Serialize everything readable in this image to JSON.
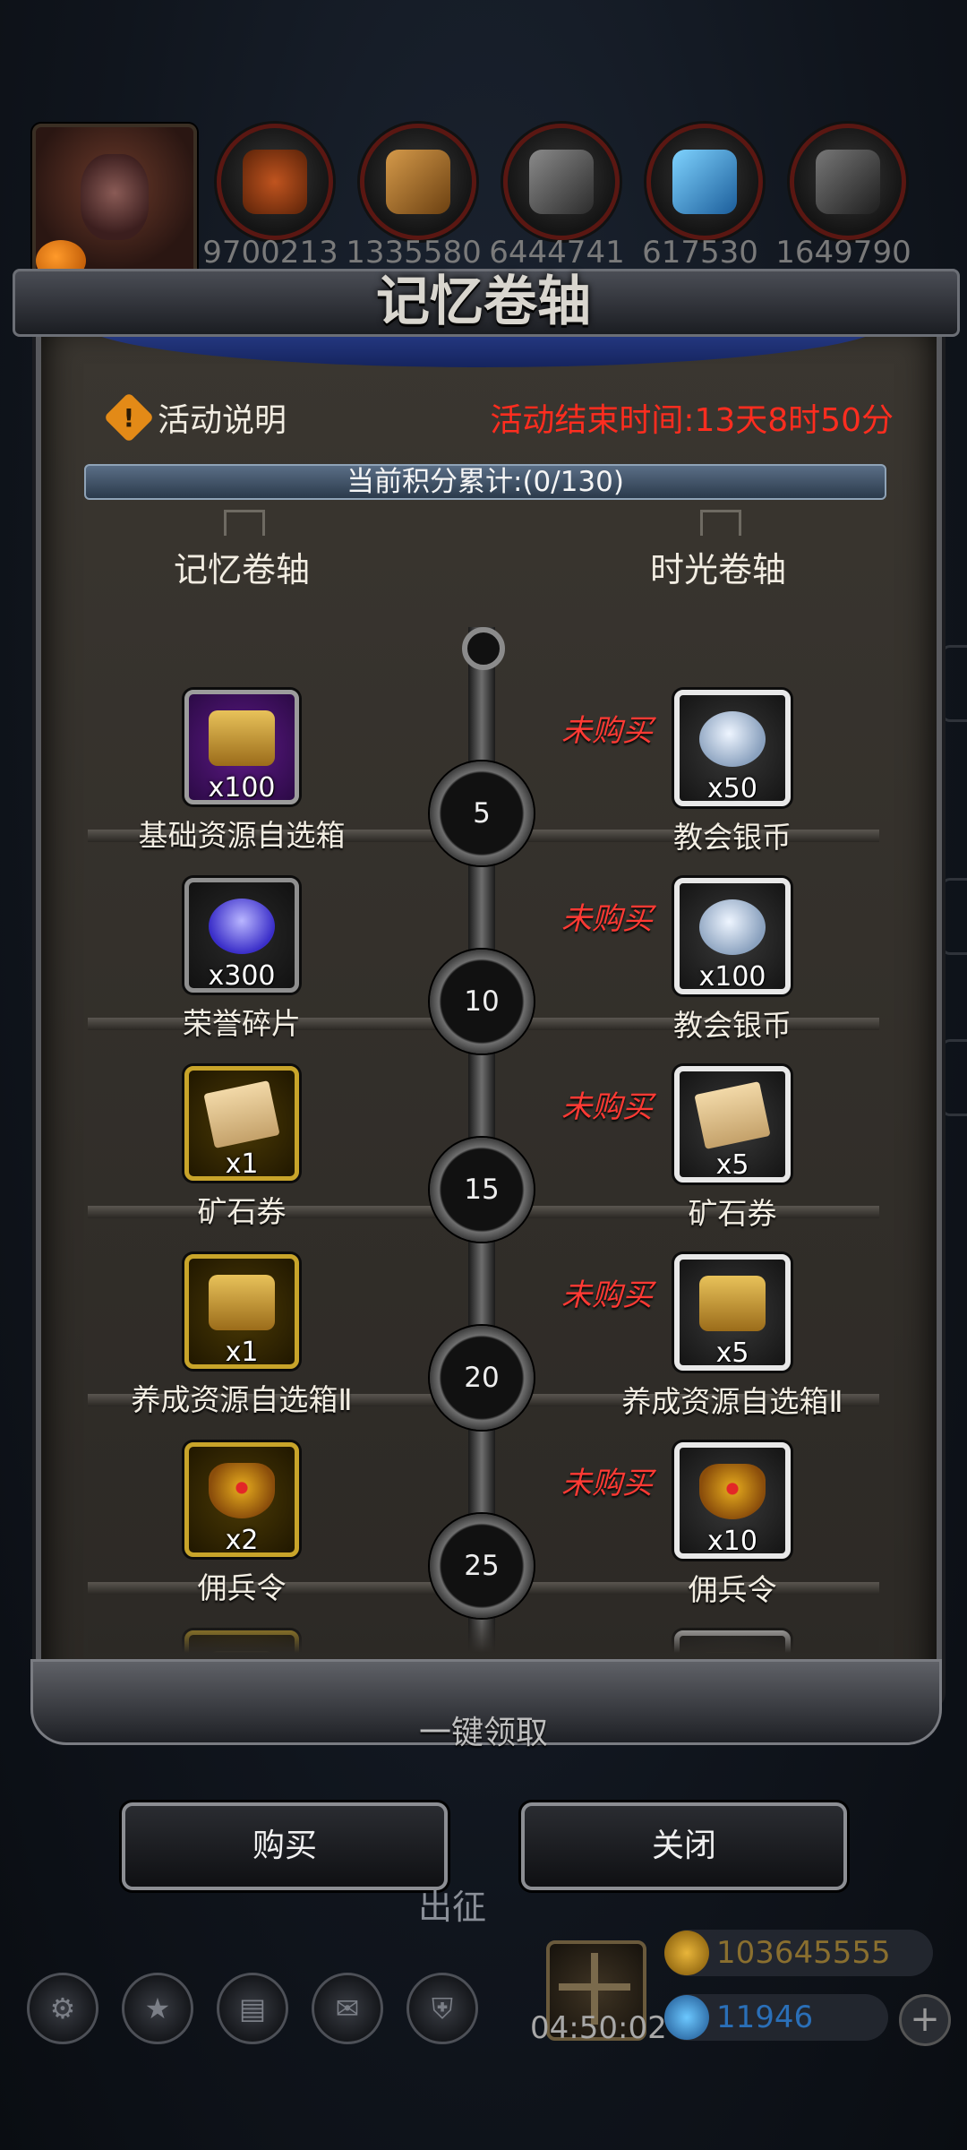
{
  "resources": {
    "values": [
      "9700213",
      "1335580",
      "6444741",
      "617530",
      "1649790"
    ],
    "colors": [
      "#c0541f",
      "#b07a33",
      "#5a5a5a",
      "#3aa3e0",
      "#4a4a4a"
    ]
  },
  "dialog": {
    "title": "记忆卷轴",
    "info_label": "活动说明",
    "info_icon": "warning-icon",
    "end_time": "活动结束时间:13天8时50分",
    "progress_text": "当前积分累计:(0/130)",
    "score_current": 0,
    "score_max": 130,
    "left_column": "记忆卷轴",
    "right_column": "时光卷轴",
    "rows": [
      {
        "points": "5",
        "left": {
          "name": "基础资源自选箱",
          "qty": "x100",
          "icon": "chest-icon"
        },
        "status": "未购买",
        "right": {
          "name": "教会银币",
          "qty": "x50",
          "icon": "silver-coin-icon"
        }
      },
      {
        "points": "10",
        "left": {
          "name": "荣誉碎片",
          "qty": "x300",
          "icon": "honor-shard-icon"
        },
        "status": "未购买",
        "right": {
          "name": "教会银币",
          "qty": "x100",
          "icon": "silver-coin-icon"
        }
      },
      {
        "points": "15",
        "left": {
          "name": "矿石券",
          "qty": "x1",
          "icon": "ore-ticket-icon"
        },
        "status": "未购买",
        "right": {
          "name": "矿石券",
          "qty": "x5",
          "icon": "ore-ticket-icon"
        }
      },
      {
        "points": "20",
        "left": {
          "name": "养成资源自选箱Ⅱ",
          "qty": "x1",
          "icon": "chest-icon"
        },
        "status": "未购买",
        "right": {
          "name": "养成资源自选箱Ⅱ",
          "qty": "x5",
          "icon": "chest-icon"
        }
      },
      {
        "points": "25",
        "left": {
          "name": "佣兵令",
          "qty": "x2",
          "icon": "mercenary-badge-icon"
        },
        "status": "未购买",
        "right": {
          "name": "佣兵令",
          "qty": "x10",
          "icon": "mercenary-badge-icon"
        }
      }
    ],
    "claim_all": "一键领取",
    "buy_button": "购买",
    "close_button": "关闭"
  },
  "background": {
    "sortie_label": "出征",
    "timer": "04:50:02",
    "gold": "103645555",
    "gems": "11946"
  }
}
